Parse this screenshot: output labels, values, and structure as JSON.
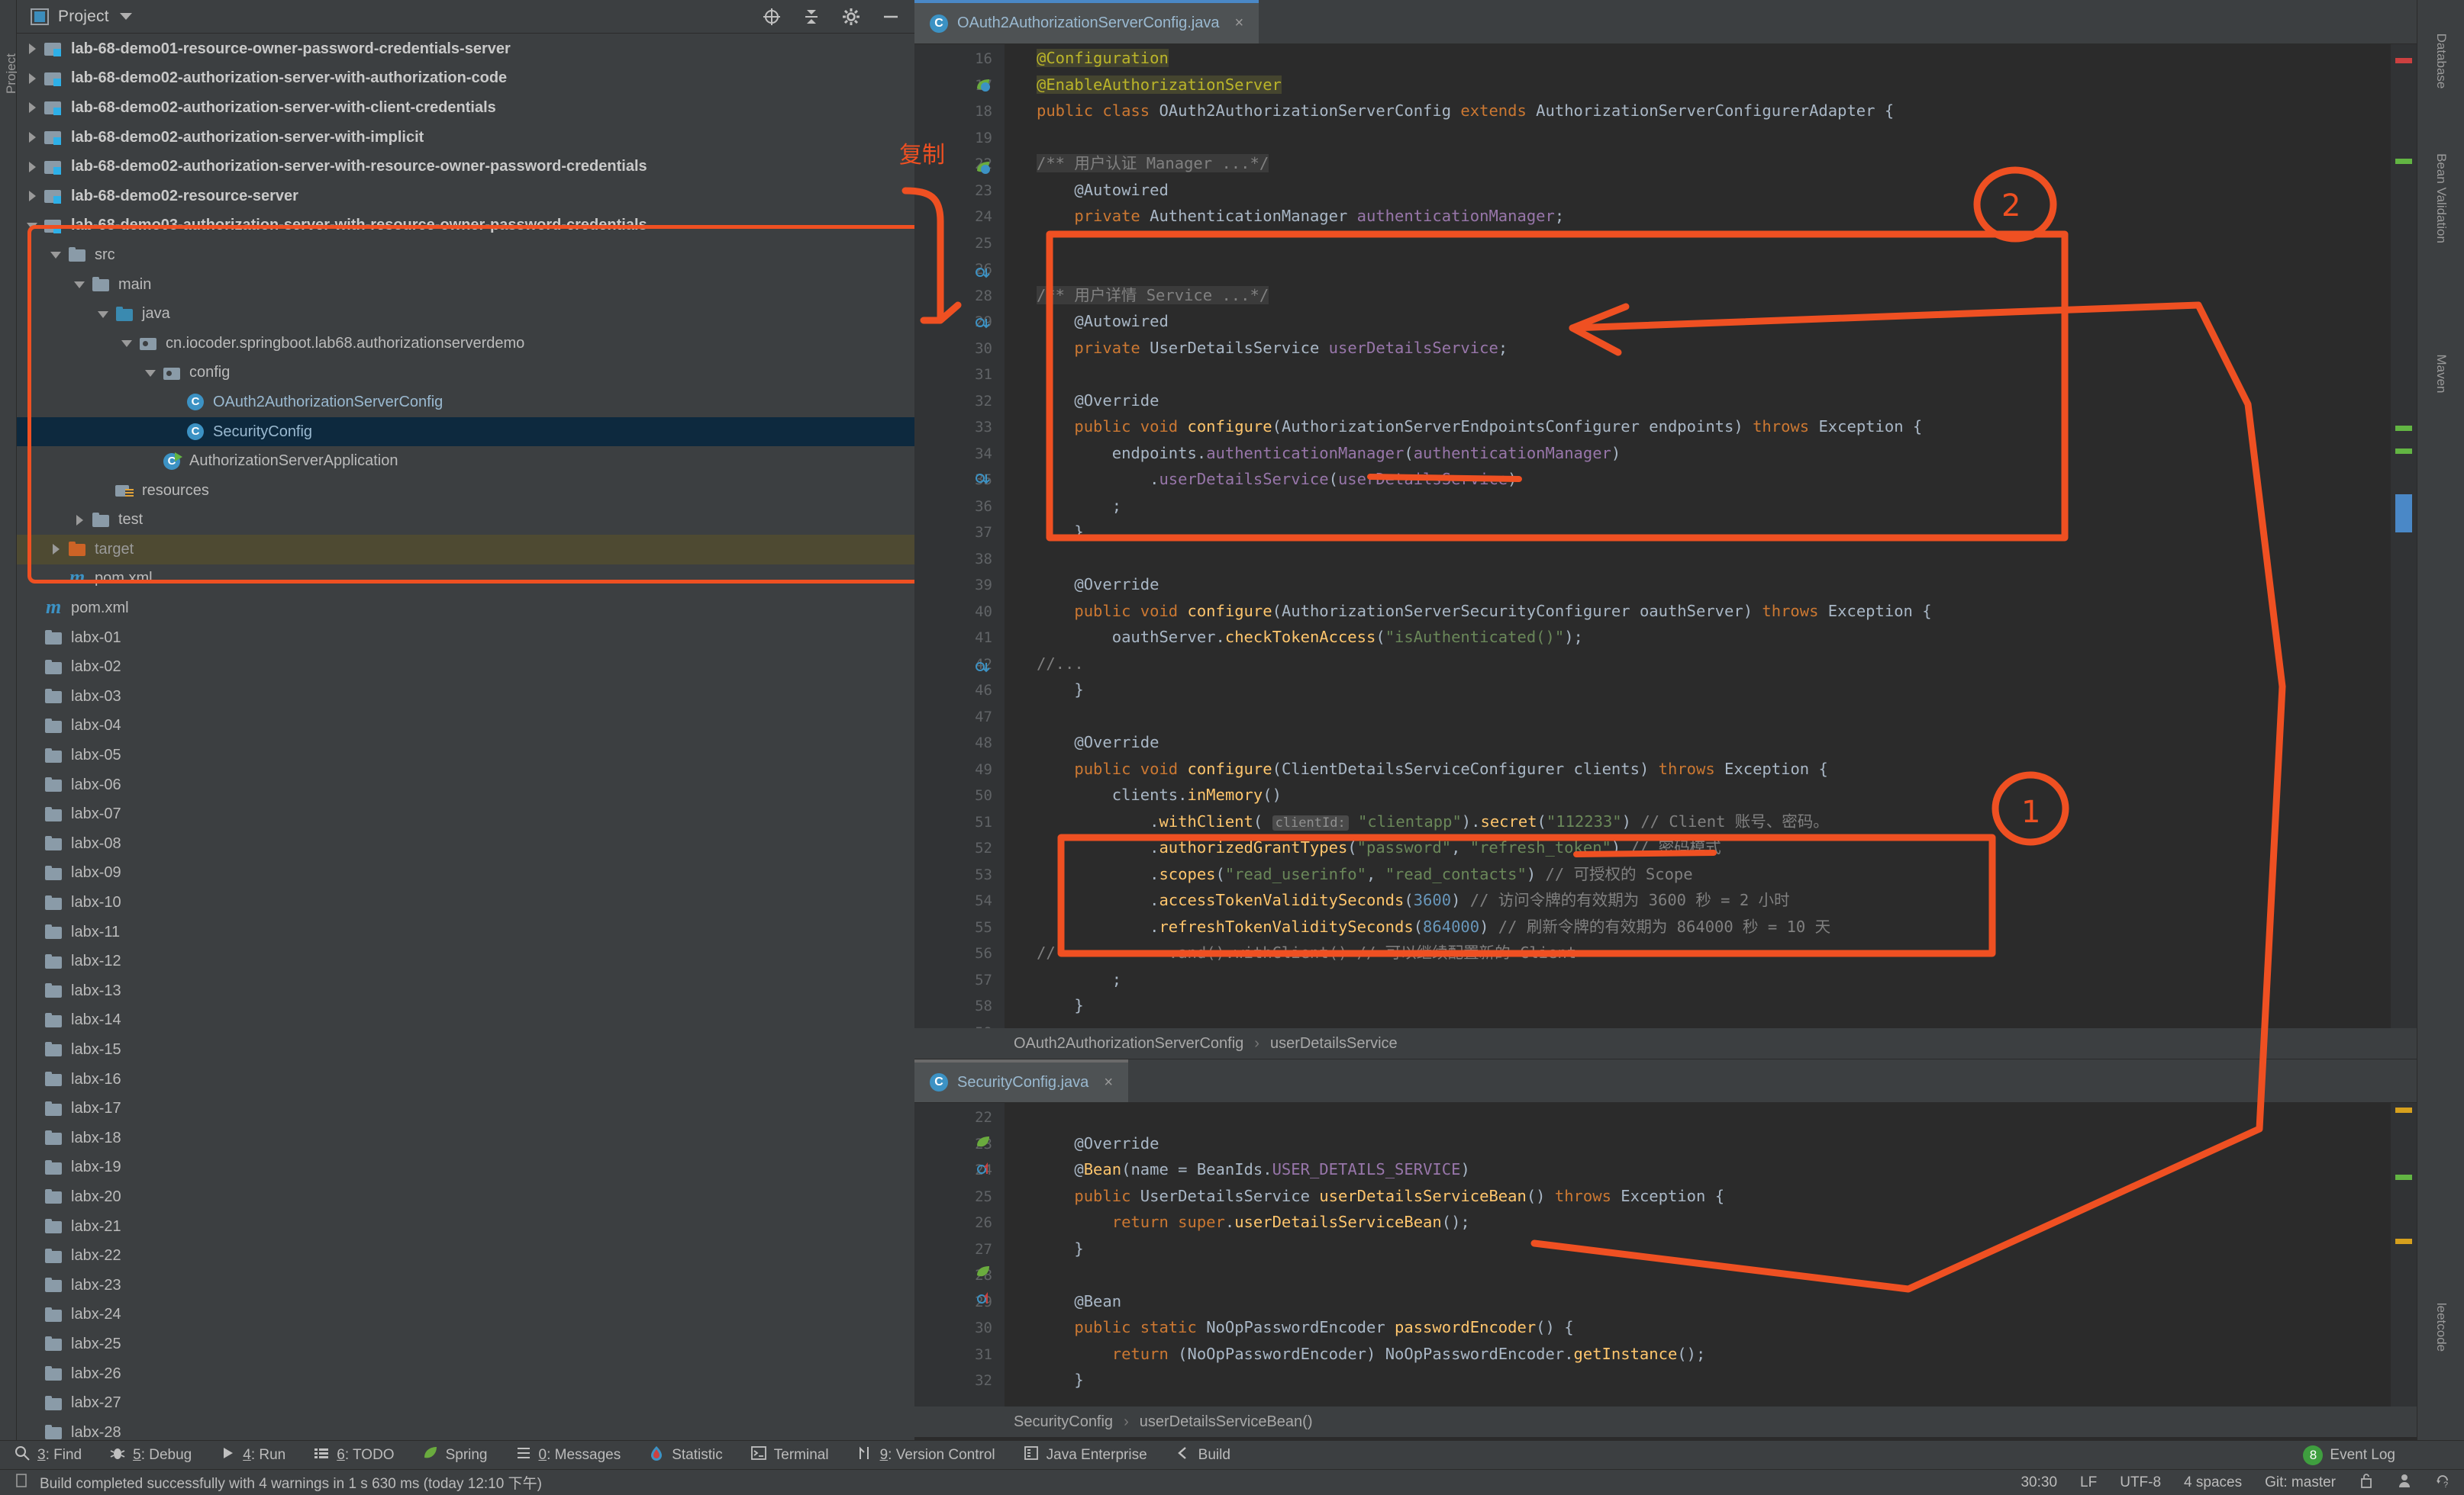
{
  "window": {
    "left_strip_label": "Project",
    "right_strips": [
      "Database",
      "Bean Validation",
      "Maven",
      "leetcode"
    ]
  },
  "project_panel": {
    "title": "Project",
    "tools": [
      "locate-icon",
      "collapse-all-icon",
      "settings-icon",
      "minimize-icon"
    ],
    "tree": [
      {
        "label": "lab-68-demo01-resource-owner-password-credentials-server",
        "icon": "module-folder",
        "arrow": "right",
        "depth": 0,
        "bold": true
      },
      {
        "label": "lab-68-demo02-authorization-server-with-authorization-code",
        "icon": "module-folder",
        "arrow": "right",
        "depth": 0,
        "bold": true
      },
      {
        "label": "lab-68-demo02-authorization-server-with-client-credentials",
        "icon": "module-folder",
        "arrow": "right",
        "depth": 0,
        "bold": true
      },
      {
        "label": "lab-68-demo02-authorization-server-with-implicit",
        "icon": "module-folder",
        "arrow": "right",
        "depth": 0,
        "bold": true
      },
      {
        "label": "lab-68-demo02-authorization-server-with-resource-owner-password-credentials",
        "icon": "module-folder",
        "arrow": "right",
        "depth": 0,
        "bold": true
      },
      {
        "label": "lab-68-demo02-resource-server",
        "icon": "module-folder",
        "arrow": "right",
        "depth": 0,
        "bold": true
      },
      {
        "label": "lab-68-demo03-authorization-server-with-resource-owner-password-credentials",
        "icon": "module-folder",
        "arrow": "down",
        "depth": 0,
        "bold": true
      },
      {
        "label": "src",
        "icon": "folder",
        "arrow": "down",
        "depth": 1
      },
      {
        "label": "main",
        "icon": "folder",
        "arrow": "down",
        "depth": 2
      },
      {
        "label": "java",
        "icon": "folder-blue",
        "arrow": "down",
        "depth": 3
      },
      {
        "label": "cn.iocoder.springboot.lab68.authorizationserverdemo",
        "icon": "package",
        "arrow": "down",
        "depth": 4
      },
      {
        "label": "config",
        "icon": "package",
        "arrow": "down",
        "depth": 5
      },
      {
        "label": "OAuth2AuthorizationServerConfig",
        "icon": "java-class",
        "arrow": "none",
        "depth": 6,
        "style": "class"
      },
      {
        "label": "SecurityConfig",
        "icon": "java-class",
        "arrow": "none",
        "depth": 6,
        "style": "class",
        "state": "selected"
      },
      {
        "label": "AuthorizationServerApplication",
        "icon": "java-class-runnable",
        "arrow": "none",
        "depth": 5,
        "style": "class-plain"
      },
      {
        "label": "resources",
        "icon": "resources-folder",
        "arrow": "none",
        "depth": 3
      },
      {
        "label": "test",
        "icon": "folder",
        "arrow": "right",
        "depth": 2
      },
      {
        "label": "target",
        "icon": "folder-orange",
        "arrow": "right",
        "depth": 1,
        "state": "excluded",
        "style": "dim"
      },
      {
        "label": "pom.xml",
        "icon": "maven",
        "arrow": "none",
        "depth": 1
      },
      {
        "label": "pom.xml",
        "icon": "maven",
        "arrow": "none",
        "depth": 0
      },
      {
        "label": "labx-01",
        "icon": "folder",
        "arrow": "none",
        "depth": 0
      },
      {
        "label": "labx-02",
        "icon": "folder",
        "arrow": "none",
        "depth": 0
      },
      {
        "label": "labx-03",
        "icon": "folder",
        "arrow": "none",
        "depth": 0
      },
      {
        "label": "labx-04",
        "icon": "folder",
        "arrow": "none",
        "depth": 0
      },
      {
        "label": "labx-05",
        "icon": "folder",
        "arrow": "none",
        "depth": 0
      },
      {
        "label": "labx-06",
        "icon": "folder",
        "arrow": "none",
        "depth": 0
      },
      {
        "label": "labx-07",
        "icon": "folder",
        "arrow": "none",
        "depth": 0
      },
      {
        "label": "labx-08",
        "icon": "folder",
        "arrow": "none",
        "depth": 0
      },
      {
        "label": "labx-09",
        "icon": "folder",
        "arrow": "none",
        "depth": 0
      },
      {
        "label": "labx-10",
        "icon": "folder",
        "arrow": "none",
        "depth": 0
      },
      {
        "label": "labx-11",
        "icon": "folder",
        "arrow": "none",
        "depth": 0
      },
      {
        "label": "labx-12",
        "icon": "folder",
        "arrow": "none",
        "depth": 0
      },
      {
        "label": "labx-13",
        "icon": "folder",
        "arrow": "none",
        "depth": 0
      },
      {
        "label": "labx-14",
        "icon": "folder",
        "arrow": "none",
        "depth": 0
      },
      {
        "label": "labx-15",
        "icon": "folder",
        "arrow": "none",
        "depth": 0
      },
      {
        "label": "labx-16",
        "icon": "folder",
        "arrow": "none",
        "depth": 0
      },
      {
        "label": "labx-17",
        "icon": "folder",
        "arrow": "none",
        "depth": 0
      },
      {
        "label": "labx-18",
        "icon": "folder",
        "arrow": "none",
        "depth": 0
      },
      {
        "label": "labx-19",
        "icon": "folder",
        "arrow": "none",
        "depth": 0
      },
      {
        "label": "labx-20",
        "icon": "folder",
        "arrow": "none",
        "depth": 0
      },
      {
        "label": "labx-21",
        "icon": "folder",
        "arrow": "none",
        "depth": 0
      },
      {
        "label": "labx-22",
        "icon": "folder",
        "arrow": "none",
        "depth": 0
      },
      {
        "label": "labx-23",
        "icon": "folder",
        "arrow": "none",
        "depth": 0
      },
      {
        "label": "labx-24",
        "icon": "folder",
        "arrow": "none",
        "depth": 0
      },
      {
        "label": "labx-25",
        "icon": "folder",
        "arrow": "none",
        "depth": 0
      },
      {
        "label": "labx-26",
        "icon": "folder",
        "arrow": "none",
        "depth": 0
      },
      {
        "label": "labx-27",
        "icon": "folder",
        "arrow": "none",
        "depth": 0
      },
      {
        "label": "labx-28",
        "icon": "folder",
        "arrow": "none",
        "depth": 0
      }
    ]
  },
  "editor_top": {
    "tab": {
      "label": "OAuth2AuthorizationServerConfig.java",
      "icon": "java-class-icon",
      "close": "×"
    },
    "first_line_number": 16,
    "lines": [
      {
        "n": 16,
        "text": "@Configuration"
      },
      {
        "n": 17,
        "text": "@EnableAuthorizationServer"
      },
      {
        "n": 18,
        "text": "public class OAuth2AuthorizationServerConfig extends AuthorizationServerConfigurerAdapter {"
      },
      {
        "n": 19,
        "text": ""
      },
      {
        "n": 22,
        "text": "    /** 用户认证 Manager ...*/"
      },
      {
        "n": 23,
        "text": "    @Autowired"
      },
      {
        "n": 24,
        "text": "    private AuthenticationManager authenticationManager;"
      },
      {
        "n": 25,
        "text": ""
      },
      {
        "n": 26,
        "text": ""
      },
      {
        "n": 28,
        "text": "    /** 用户详情 Service ...*/"
      },
      {
        "n": 29,
        "text": "    @Autowired"
      },
      {
        "n": 30,
        "text": "    private UserDetailsService userDetailsService;"
      },
      {
        "n": 31,
        "text": ""
      },
      {
        "n": 32,
        "text": "    @Override"
      },
      {
        "n": 33,
        "text": "    public void configure(AuthorizationServerEndpointsConfigurer endpoints) throws Exception {"
      },
      {
        "n": 34,
        "text": "        endpoints.authenticationManager(authenticationManager)"
      },
      {
        "n": 35,
        "text": "            .userDetailsService(userDetailsService)"
      },
      {
        "n": 36,
        "text": "        ;"
      },
      {
        "n": 37,
        "text": "    }"
      },
      {
        "n": 38,
        "text": ""
      },
      {
        "n": 39,
        "text": "    @Override"
      },
      {
        "n": 40,
        "text": "    public void configure(AuthorizationServerSecurityConfigurer oauthServer) throws Exception {"
      },
      {
        "n": 41,
        "text": "        oauthServer.checkTokenAccess(\"isAuthenticated()\");"
      },
      {
        "n": 42,
        "text": "//..."
      },
      {
        "n": 46,
        "text": "    }"
      },
      {
        "n": 47,
        "text": ""
      },
      {
        "n": 48,
        "text": "    @Override"
      },
      {
        "n": 49,
        "text": "    public void configure(ClientDetailsServiceConfigurer clients) throws Exception {"
      },
      {
        "n": 50,
        "text": "        clients.inMemory()"
      },
      {
        "n": 51,
        "text": "            .withClient( clientId: \"clientapp\").secret(\"112233\") // Client 账号、密码。"
      },
      {
        "n": 52,
        "text": "            .authorizedGrantTypes(\"password\", \"refresh_token\") // 密码模式"
      },
      {
        "n": 53,
        "text": "            .scopes(\"read_userinfo\", \"read_contacts\") // 可授权的 Scope"
      },
      {
        "n": 54,
        "text": "            .accessTokenValiditySeconds(3600) // 访问令牌的有效期为 3600 秒 = 2 小时"
      },
      {
        "n": 55,
        "text": "            .refreshTokenValiditySeconds(864000) // 刷新令牌的有效期为 864000 秒 = 10 天"
      },
      {
        "n": 56,
        "text": "//            .and().withClient() // 可以继续配置新的 Client"
      },
      {
        "n": 57,
        "text": "        ;"
      },
      {
        "n": 58,
        "text": "    }"
      },
      {
        "n": 59,
        "text": ""
      }
    ],
    "breadcrumb": [
      "OAuth2AuthorizationServerConfig",
      "userDetailsService"
    ]
  },
  "editor_bottom": {
    "tab": {
      "label": "SecurityConfig.java",
      "icon": "java-class-icon",
      "close": "×"
    },
    "lines": [
      {
        "n": 22,
        "text": ""
      },
      {
        "n": 23,
        "text": "    @Override"
      },
      {
        "n": 24,
        "text": "    @Bean(name = BeanIds.USER_DETAILS_SERVICE)"
      },
      {
        "n": 25,
        "text": "    public UserDetailsService userDetailsServiceBean() throws Exception {"
      },
      {
        "n": 26,
        "text": "        return super.userDetailsServiceBean();"
      },
      {
        "n": 27,
        "text": "    }"
      },
      {
        "n": 28,
        "text": ""
      },
      {
        "n": 29,
        "text": "    @Bean"
      },
      {
        "n": 30,
        "text": "    public static NoOpPasswordEncoder passwordEncoder() {"
      },
      {
        "n": 31,
        "text": "        return (NoOpPasswordEncoder) NoOpPasswordEncoder.getInstance();"
      },
      {
        "n": 32,
        "text": "    }"
      }
    ],
    "breadcrumb": [
      "SecurityConfig",
      "userDetailsServiceBean()"
    ]
  },
  "annotations": {
    "copy_label": "复制",
    "circle_1": "1",
    "circle_2": "2",
    "color": "#ef5022"
  },
  "bottom_toolbar": [
    {
      "num": "3",
      "label": "Find",
      "icon": "search-icon"
    },
    {
      "num": "5",
      "label": "Debug",
      "icon": "debug-icon"
    },
    {
      "num": "4",
      "label": "Run",
      "icon": "run-icon"
    },
    {
      "num": "6",
      "label": "TODO",
      "icon": "todo-icon"
    },
    {
      "num": "",
      "label": "Spring",
      "icon": "spring-leaf-icon"
    },
    {
      "num": "0",
      "label": "Messages",
      "icon": "messages-icon"
    },
    {
      "num": "",
      "label": "Statistic",
      "icon": "statistic-icon"
    },
    {
      "num": "",
      "label": "Terminal",
      "icon": "terminal-icon"
    },
    {
      "num": "9",
      "label": "Version Control",
      "icon": "vcs-icon"
    },
    {
      "num": "",
      "label": "Java Enterprise",
      "icon": "java-enterprise-icon"
    },
    {
      "num": "",
      "label": "Build",
      "icon": "build-icon"
    }
  ],
  "event_log": {
    "count": "8",
    "label": "Event Log"
  },
  "statusbar": {
    "message": "Build completed successfully with 4 warnings in 1 s 630 ms (today 12:10 下午)",
    "caret": "30:30",
    "line_separator": "LF",
    "encoding": "UTF-8",
    "indent": "4 spaces",
    "branch": "Git: master",
    "icons": [
      "lock-icon",
      "inspector-icon",
      "sync-icon"
    ]
  }
}
